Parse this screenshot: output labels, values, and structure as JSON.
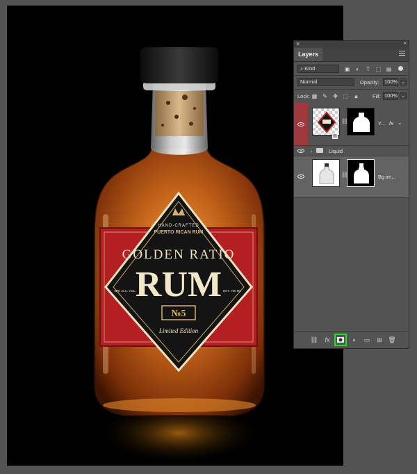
{
  "canvas": {
    "label": {
      "tagline_top": "HAND-CRAFTED",
      "tagline": "PUERTO RICAN RUM",
      "brand": "GOLDEN RATIO",
      "product": "RUM",
      "number": "№5",
      "edition": "Limited Edition",
      "abv": "40% ALC. VOL.",
      "volume": "NET. 750 ML"
    },
    "colors": {
      "rum": "#c0661c",
      "label_red": "#b41f24",
      "label_black": "#141414",
      "label_cream": "#efe3c2",
      "cap": "#1e1e1e"
    }
  },
  "panel": {
    "title_tab": "Layers",
    "filter_kind": "Kind",
    "blend_mode": "Normal",
    "opacity_label": "Opacity:",
    "opacity_value": "100%",
    "lock_label": "Lock:",
    "fill_label": "Fill:",
    "fill_value": "100%",
    "layers": [
      {
        "name": "Y...",
        "visible": true,
        "fx": "fx"
      },
      {
        "name": "Liquid",
        "visible": true,
        "type": "group"
      },
      {
        "name": "Bg im...",
        "visible": true
      }
    ],
    "accent_highlight": "#19e619"
  }
}
